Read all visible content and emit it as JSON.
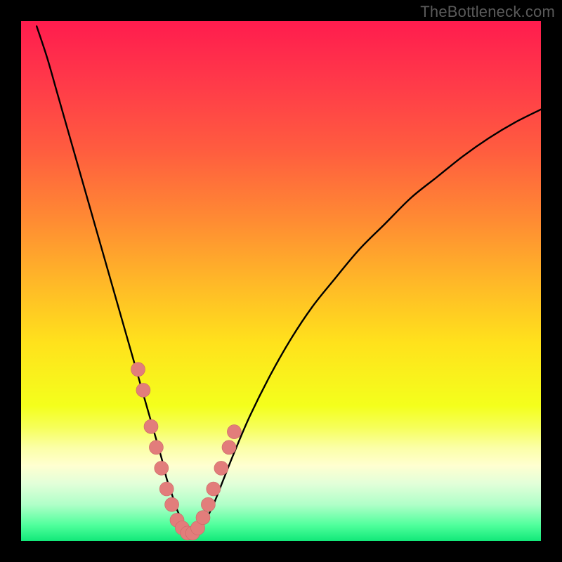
{
  "watermark": "TheBottleneck.com",
  "colors": {
    "black": "#000000",
    "curve": "#000000",
    "marker_fill": "#e27d7b",
    "marker_stroke": "#c96866",
    "gradient_stops": [
      {
        "offset": 0.0,
        "color": "#ff1c4e"
      },
      {
        "offset": 0.12,
        "color": "#ff3a49"
      },
      {
        "offset": 0.25,
        "color": "#ff5d3f"
      },
      {
        "offset": 0.38,
        "color": "#ff8a33"
      },
      {
        "offset": 0.5,
        "color": "#ffb728"
      },
      {
        "offset": 0.62,
        "color": "#ffe21c"
      },
      {
        "offset": 0.74,
        "color": "#f4ff1c"
      },
      {
        "offset": 0.78,
        "color": "#f6ff57"
      },
      {
        "offset": 0.82,
        "color": "#fbffa6"
      },
      {
        "offset": 0.855,
        "color": "#ffffd0"
      },
      {
        "offset": 0.89,
        "color": "#e2ffd9"
      },
      {
        "offset": 0.93,
        "color": "#b0ffc8"
      },
      {
        "offset": 0.97,
        "color": "#4fff9c"
      },
      {
        "offset": 1.0,
        "color": "#12e879"
      }
    ]
  },
  "chart_data": {
    "type": "line",
    "title": "",
    "xlabel": "",
    "ylabel": "",
    "xlim": [
      0,
      100
    ],
    "ylim": [
      0,
      100
    ],
    "series": [
      {
        "name": "bottleneck-curve",
        "x": [
          3,
          5,
          7,
          9,
          11,
          13,
          15,
          17,
          19,
          21,
          23,
          25,
          27,
          28,
          29,
          30,
          31,
          32,
          33,
          34,
          35,
          37,
          39,
          41,
          44,
          48,
          52,
          56,
          60,
          65,
          70,
          75,
          80,
          85,
          90,
          95,
          100
        ],
        "y": [
          99,
          93,
          86,
          79,
          72,
          65,
          58,
          51,
          44,
          37,
          30,
          23,
          16,
          12,
          9,
          6,
          4,
          2.5,
          1.5,
          1.5,
          3,
          7,
          12,
          17,
          24,
          32,
          39,
          45,
          50,
          56,
          61,
          66,
          70,
          74,
          77.5,
          80.5,
          83
        ]
      },
      {
        "name": "marker-points",
        "x": [
          22.5,
          23.5,
          25,
          26,
          27,
          28,
          29,
          30,
          31,
          32,
          33,
          34,
          35,
          36,
          37,
          38.5,
          40,
          41
        ],
        "y": [
          33,
          29,
          22,
          18,
          14,
          10,
          7,
          4,
          2.5,
          1.5,
          1.5,
          2.5,
          4.5,
          7,
          10,
          14,
          18,
          21
        ]
      }
    ]
  }
}
